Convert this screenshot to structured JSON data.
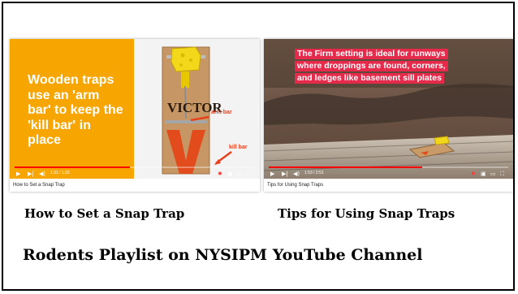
{
  "videos": [
    {
      "slide_text": "Wooden traps use an 'arm bar' to keep the 'kill bar' in place",
      "brand_text": "VICTOR",
      "annotations": [
        "arm bar",
        "kill bar"
      ],
      "time": "1:31 / 1:33",
      "caption": "How to Set a Snap Trap",
      "title": "How to Set a Snap Trap",
      "progress": 0.48
    },
    {
      "banner_lines": [
        "The Firm setting is ideal for runways",
        "where droppings are found, corners,",
        "and ledges like basement sill plates"
      ],
      "time": "1:53 / 2:51",
      "caption": "Tips for Using Snap Traps",
      "title": "Tips for Using Snap Traps",
      "progress": 0.64
    }
  ],
  "playlist_title": "Rodents Playlist on NYSIPM YouTube Channel",
  "colors": {
    "orange": "#f7a500",
    "banner_red": "#e62a4b",
    "annotation_red": "#e8401c",
    "progress_red": "#ff0000"
  },
  "icons": [
    "play-icon",
    "next-icon",
    "volume-icon",
    "settings-icon",
    "miniplayer-icon",
    "theater-icon",
    "fullscreen-icon"
  ]
}
